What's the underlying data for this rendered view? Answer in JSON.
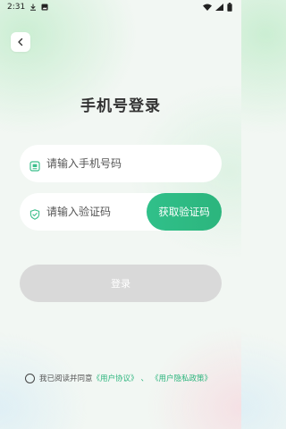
{
  "status_bar": {
    "time": "2:31",
    "icons": [
      "download-icon",
      "image-notification-icon",
      "wifi-icon",
      "cellular-signal-icon",
      "battery-icon"
    ]
  },
  "header": {
    "back_icon": "chevron-left-icon",
    "title": "手机号登录"
  },
  "form": {
    "phone": {
      "placeholder": "请输入手机号码",
      "value": "",
      "icon": "phone-icon"
    },
    "code": {
      "placeholder": "请输入验证码",
      "value": "",
      "icon": "shield-icon"
    },
    "get_code_label": "获取验证码",
    "login_label": "登录"
  },
  "agreement": {
    "checked": false,
    "prefix": "我已阅读并同意",
    "user_agreement": "《用户协议》",
    "separator": "、",
    "privacy_policy": "《用户隐私政策》"
  },
  "colors": {
    "accent": "#2cb57d",
    "login_disabled": "#d9d9d9",
    "title": "#333333"
  }
}
